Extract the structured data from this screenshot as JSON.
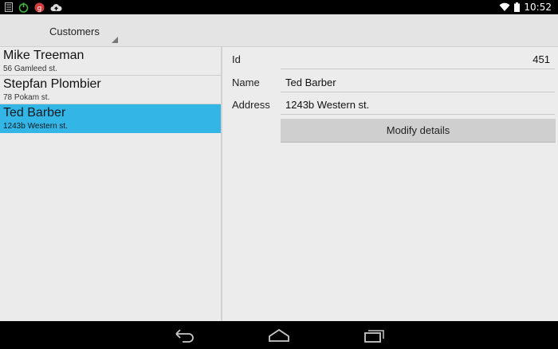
{
  "status_bar": {
    "time": "10:52",
    "left_icons": [
      "storage-icon",
      "power-icon",
      "app-g-icon",
      "cloud-upload-icon"
    ],
    "right_icons": [
      "wifi-icon",
      "battery-icon"
    ]
  },
  "action_bar": {
    "spinner_label": "Customers"
  },
  "customers": [
    {
      "name": "Mike Treeman",
      "address": "56 Gamleed st."
    },
    {
      "name": "Stepfan Plombier",
      "address": "78 Pokam st."
    },
    {
      "name": "Ted Barber",
      "address": "1243b Western st.",
      "selected": true
    }
  ],
  "detail": {
    "id_label": "Id",
    "id_value": "451",
    "name_label": "Name",
    "name_value": "Ted Barber",
    "address_label": "Address",
    "address_value": "1243b Western st.",
    "modify_button": "Modify details"
  },
  "nav_bar": {
    "buttons": [
      "back-icon",
      "home-icon",
      "recents-icon"
    ]
  },
  "colors": {
    "selection": "#33b5e5",
    "background": "#ebebeb",
    "bars": "#000000"
  }
}
